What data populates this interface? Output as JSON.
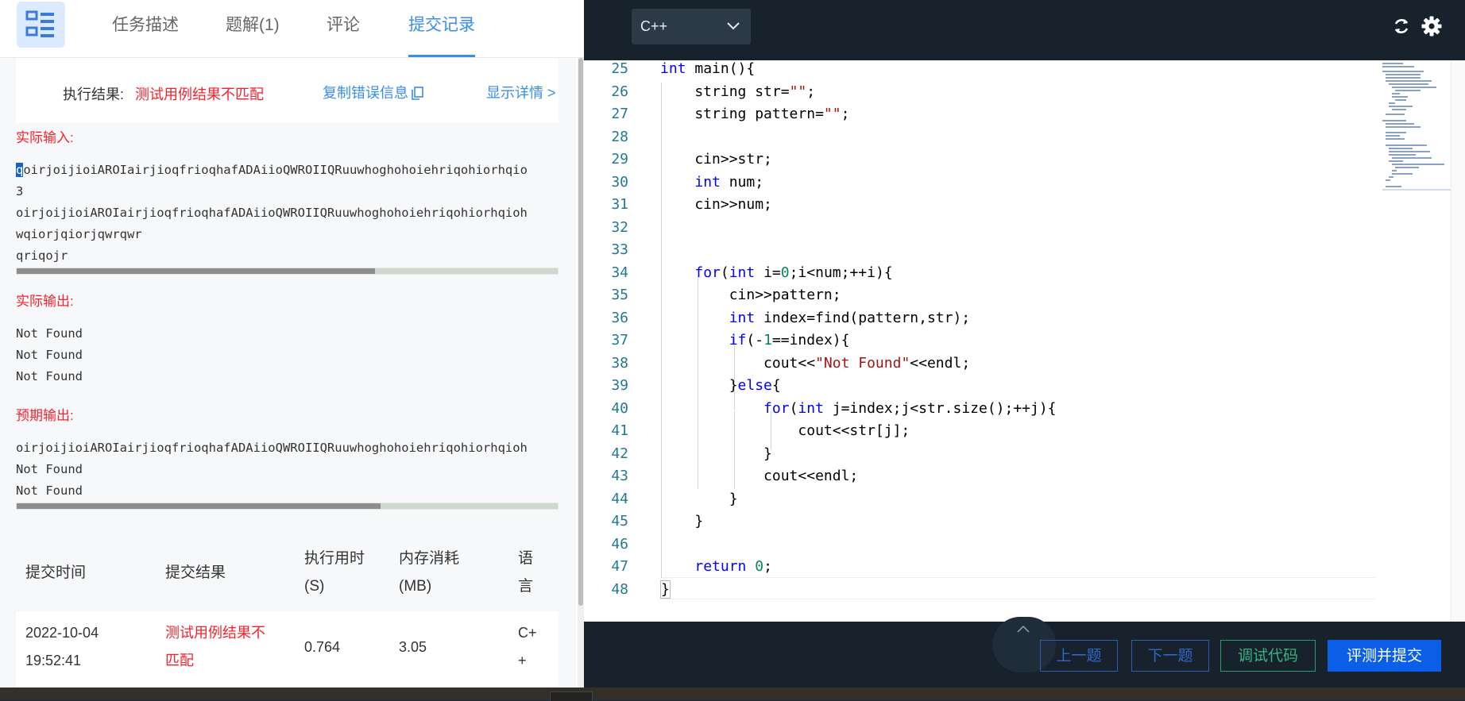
{
  "tabs": [
    {
      "label": "任务描述"
    },
    {
      "label": "题解(1)"
    },
    {
      "label": "评论"
    },
    {
      "label": "提交记录"
    }
  ],
  "result": {
    "label": "执行结果:",
    "value": "测试用例结果不匹配",
    "copy_label": "复制错误信息",
    "detail_label": "显示详情 >"
  },
  "actual_input": {
    "title": "实际输入:",
    "first_char": "q",
    "line1_rest": "oirjoijioiAROIairjioqfrioqhafADAiioQWROIIQRuuwhoghohoiehriqohiorhqio",
    "lines": [
      "3",
      "oirjoijioiAROIairjioqfrioqhafADAiioQWROIIQRuuwhoghohoiehriqohiorhqioh",
      "wqiorjqiorjqwrqwr",
      "qriqojr"
    ],
    "scroll_fraction": 0.66
  },
  "actual_output": {
    "title": "实际输出:",
    "lines": [
      "Not Found",
      "Not Found",
      "Not Found"
    ]
  },
  "expected_output": {
    "title": "预期输出:",
    "lines": [
      "oirjoijioiAROIairjioqfrioqhafADAiioQWROIIQRuuwhoghohoiehriqohiorhqioh",
      "Not Found",
      "Not Found"
    ],
    "scroll_fraction": 0.67
  },
  "table": {
    "headers": {
      "time": "提交时间",
      "result": "提交结果",
      "exec_time_1": "执行用时",
      "exec_time_2": "(S)",
      "memory_1": "内存消耗",
      "memory_2": "(MB)",
      "lang_1": "语",
      "lang_2": "言"
    },
    "row": {
      "date": "2022-10-04",
      "clock": "19:52:41",
      "result_1": "测试用例结果不",
      "result_2": "匹配",
      "exec_time": "0.764",
      "memory": "3.05",
      "lang_1": "C+",
      "lang_2": "+"
    }
  },
  "editor": {
    "language": "C++",
    "line_numbers": [
      "25",
      "26",
      "27",
      "28",
      "29",
      "30",
      "31",
      "32",
      "33",
      "34",
      "35",
      "36",
      "37",
      "38",
      "39",
      "40",
      "41",
      "42",
      "43",
      "44",
      "45",
      "46",
      "47",
      "48"
    ]
  },
  "buttons": {
    "prev": "上一题",
    "next": "下一题",
    "debug": "调试代码",
    "submit": "评测并提交"
  },
  "colors": {
    "accent": "#3a8ee6",
    "error": "#f5222d",
    "dark_bg": "#18222c",
    "submit": "#0b5ee8",
    "debug": "#36b37e"
  },
  "icons": [
    "menu-icon",
    "copy-icon",
    "chevron-down-icon",
    "refresh-icon",
    "gear-icon",
    "chevron-up-icon"
  ]
}
